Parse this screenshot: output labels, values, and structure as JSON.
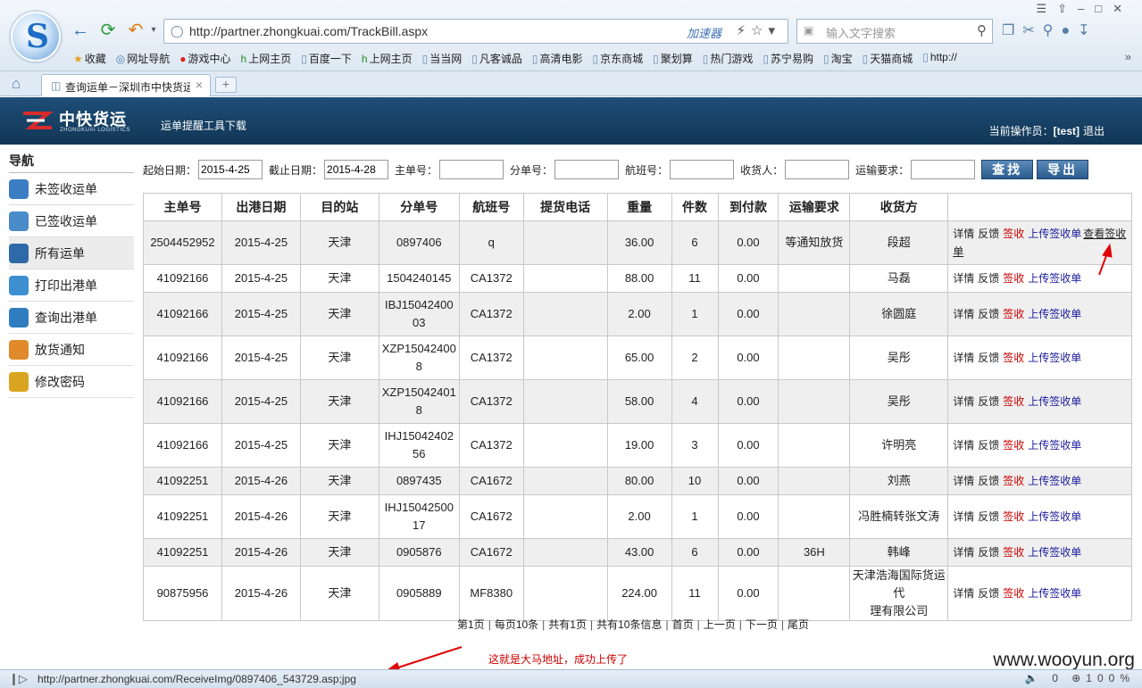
{
  "browser": {
    "url": "http://partner.zhongkuai.com/TrackBill.aspx",
    "accelerator": "加速器",
    "search_placeholder": "输入文字搜索",
    "bookmarks": [
      {
        "icon": "star-icon",
        "label": "收藏"
      },
      {
        "icon": "globe-icon",
        "label": "网址导航"
      },
      {
        "icon": "game-icon",
        "label": "游戏中心"
      },
      {
        "icon": "hao-icon",
        "label": "上网主页"
      },
      {
        "icon": "page-icon",
        "label": "百度一下"
      },
      {
        "icon": "hao-icon",
        "label": "上网主页"
      },
      {
        "icon": "page-icon",
        "label": "当当网"
      },
      {
        "icon": "page-icon",
        "label": "凡客诚品"
      },
      {
        "icon": "page-icon",
        "label": "高清电影"
      },
      {
        "icon": "page-icon",
        "label": "京东商城"
      },
      {
        "icon": "page-icon",
        "label": "聚划算"
      },
      {
        "icon": "page-icon",
        "label": "热门游戏"
      },
      {
        "icon": "page-icon",
        "label": "苏宁易购"
      },
      {
        "icon": "page-icon",
        "label": "淘宝"
      },
      {
        "icon": "page-icon",
        "label": "天猫商城"
      },
      {
        "icon": "page-icon",
        "label": "http://"
      }
    ],
    "more_bookmarks": "»",
    "tab_title": "查询运单－深圳市中快货运",
    "status_url": "http://partner.zhongkuai.com/ReceiveImg/0897406_543729.asp;jpg",
    "zoom": "100%",
    "status_count": "0"
  },
  "header": {
    "brand_name": "中快货运",
    "brand_en": "ZHONGKUAI LOGISTICS",
    "download_link": "运单提醒工具下载",
    "operator_label": "当前操作员：",
    "operator_name": "[test]",
    "logout": "退出"
  },
  "sidebar": {
    "title": "导航",
    "items": [
      {
        "label": "未签收运单",
        "icon": "unsigned-bill-icon",
        "color": "#3b7ec4"
      },
      {
        "label": "已签收运单",
        "icon": "signed-bill-icon",
        "color": "#4a8bc9"
      },
      {
        "label": "所有运单",
        "icon": "all-bills-icon",
        "color": "#2f6aa8"
      },
      {
        "label": "打印出港单",
        "icon": "print-icon",
        "color": "#3d8fd0"
      },
      {
        "label": "查询出港单",
        "icon": "monitor-icon",
        "color": "#2f7dc0"
      },
      {
        "label": "放货通知",
        "icon": "notice-icon",
        "color": "#e08a2c"
      },
      {
        "label": "修改密码",
        "icon": "lock-icon",
        "color": "#d9a520"
      }
    ]
  },
  "filter": {
    "start_label": "起始日期：",
    "start_value": "2015-4-25",
    "end_label": "截止日期：",
    "end_value": "2015-4-28",
    "master_label": "主单号：",
    "sub_label": "分单号：",
    "flight_label": "航班号：",
    "consignee_label": "收货人：",
    "transport_label": "运输要求：",
    "search_btn": "查找",
    "export_btn": "导出"
  },
  "table": {
    "headers": [
      "主单号",
      "出港日期",
      "目的站",
      "分单号",
      "航班号",
      "提货电话",
      "重量",
      "件数",
      "到付款",
      "运输要求",
      "收货方",
      ""
    ],
    "actions": {
      "detail": "详情",
      "feedback": "反馈",
      "sign": "签收",
      "upload": "上传签收单",
      "view": "查看签收单"
    },
    "rows": [
      {
        "master": "2504452952",
        "date": "2015-4-25",
        "dest": "天津",
        "sub": "0897406",
        "flight": "q",
        "phone": "",
        "weight": "36.00",
        "pieces": "6",
        "cod": "0.00",
        "req": "等通知放货",
        "consignee": "段超",
        "view": true
      },
      {
        "master": "41092166",
        "date": "2015-4-25",
        "dest": "天津",
        "sub": "1504240145",
        "flight": "CA1372",
        "phone": "",
        "weight": "88.00",
        "pieces": "11",
        "cod": "0.00",
        "req": "",
        "consignee": "马磊",
        "view": false
      },
      {
        "master": "41092166",
        "date": "2015-4-25",
        "dest": "天津",
        "sub": "IBJ15042400\n03",
        "flight": "CA1372",
        "phone": "",
        "weight": "2.00",
        "pieces": "1",
        "cod": "0.00",
        "req": "",
        "consignee": "徐圆庭",
        "view": false
      },
      {
        "master": "41092166",
        "date": "2015-4-25",
        "dest": "天津",
        "sub": "XZP15042400\n8",
        "flight": "CA1372",
        "phone": "",
        "weight": "65.00",
        "pieces": "2",
        "cod": "0.00",
        "req": "",
        "consignee": "吴彤",
        "view": false
      },
      {
        "master": "41092166",
        "date": "2015-4-25",
        "dest": "天津",
        "sub": "XZP15042401\n8",
        "flight": "CA1372",
        "phone": "",
        "weight": "58.00",
        "pieces": "4",
        "cod": "0.00",
        "req": "",
        "consignee": "吴彤",
        "view": false
      },
      {
        "master": "41092166",
        "date": "2015-4-25",
        "dest": "天津",
        "sub": "IHJ15042402\n56",
        "flight": "CA1372",
        "phone": "",
        "weight": "19.00",
        "pieces": "3",
        "cod": "0.00",
        "req": "",
        "consignee": "许明亮",
        "view": false
      },
      {
        "master": "41092251",
        "date": "2015-4-26",
        "dest": "天津",
        "sub": "0897435",
        "flight": "CA1672",
        "phone": "",
        "weight": "80.00",
        "pieces": "10",
        "cod": "0.00",
        "req": "",
        "consignee": "刘燕",
        "view": false
      },
      {
        "master": "41092251",
        "date": "2015-4-26",
        "dest": "天津",
        "sub": "IHJ15042500\n17",
        "flight": "CA1672",
        "phone": "",
        "weight": "2.00",
        "pieces": "1",
        "cod": "0.00",
        "req": "",
        "consignee": "冯胜楠转张文涛",
        "view": false
      },
      {
        "master": "41092251",
        "date": "2015-4-26",
        "dest": "天津",
        "sub": "0905876",
        "flight": "CA1672",
        "phone": "",
        "weight": "43.00",
        "pieces": "6",
        "cod": "0.00",
        "req": "36H",
        "consignee": "韩峰",
        "view": false
      },
      {
        "master": "90875956",
        "date": "2015-4-26",
        "dest": "天津",
        "sub": "0905889",
        "flight": "MF8380",
        "phone": "",
        "weight": "224.00",
        "pieces": "11",
        "cod": "0.00",
        "req": "",
        "consignee": "天津浩海国际货运代\n理有限公司",
        "view": false
      }
    ]
  },
  "pager": [
    "第1页",
    "每页10条",
    "共有1页",
    "共有10条信息",
    "首页",
    "上一页",
    "下一页",
    "尾页"
  ],
  "annotation": {
    "note": "这就是大马地址，成功上传了",
    "watermark": "www.wooyun.org",
    "arrow_color": "#e00000"
  }
}
